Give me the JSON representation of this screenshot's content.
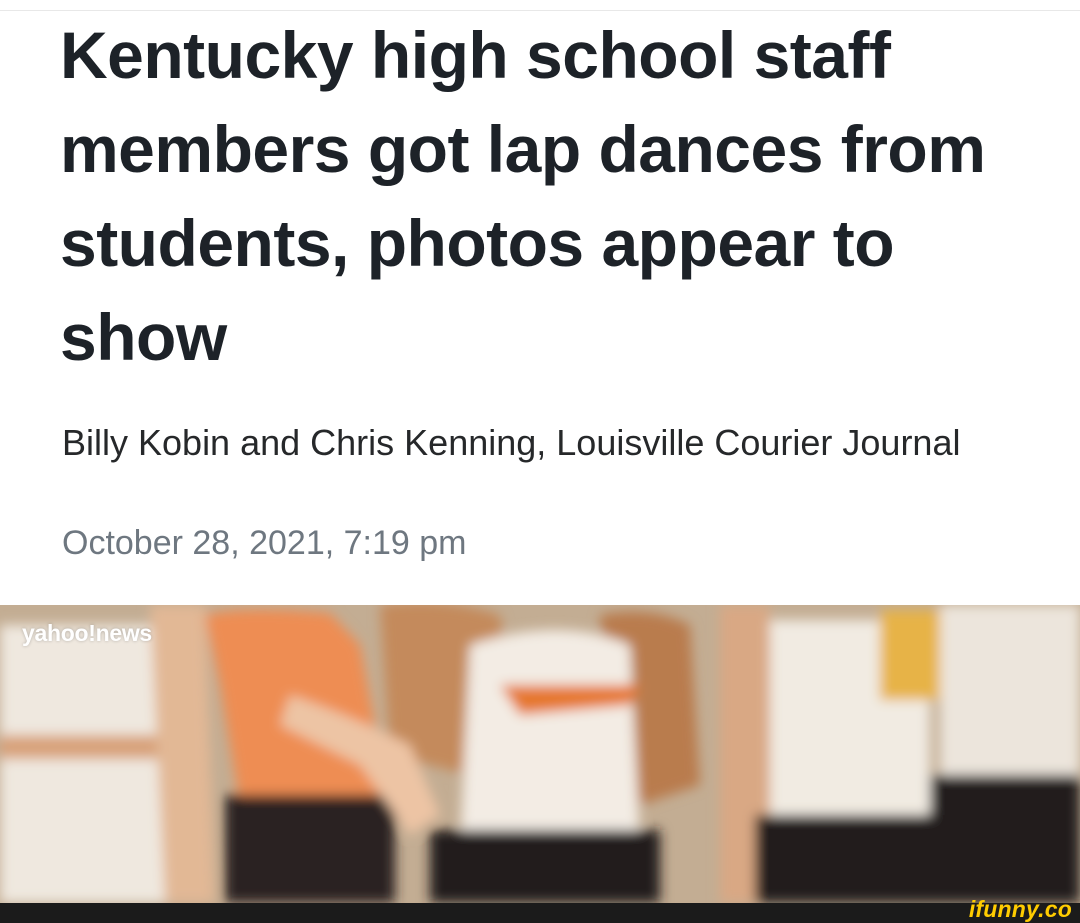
{
  "article": {
    "headline": "Kentucky high school staff members got lap dances from students, photos appear to show",
    "byline": "Billy Kobin and Chris Kenning, Louisville Courier Journal",
    "timestamp": "October 28, 2021, 7:19 pm"
  },
  "hero_image": {
    "source_logo": "yahoo!news",
    "description_icon": "photo-image"
  },
  "watermark": {
    "label": "ifunny.co"
  },
  "colors": {
    "headline": "#1d2228",
    "byline": "#26282a",
    "timestamp": "#6e7780",
    "watermark": "#ffcc00"
  }
}
